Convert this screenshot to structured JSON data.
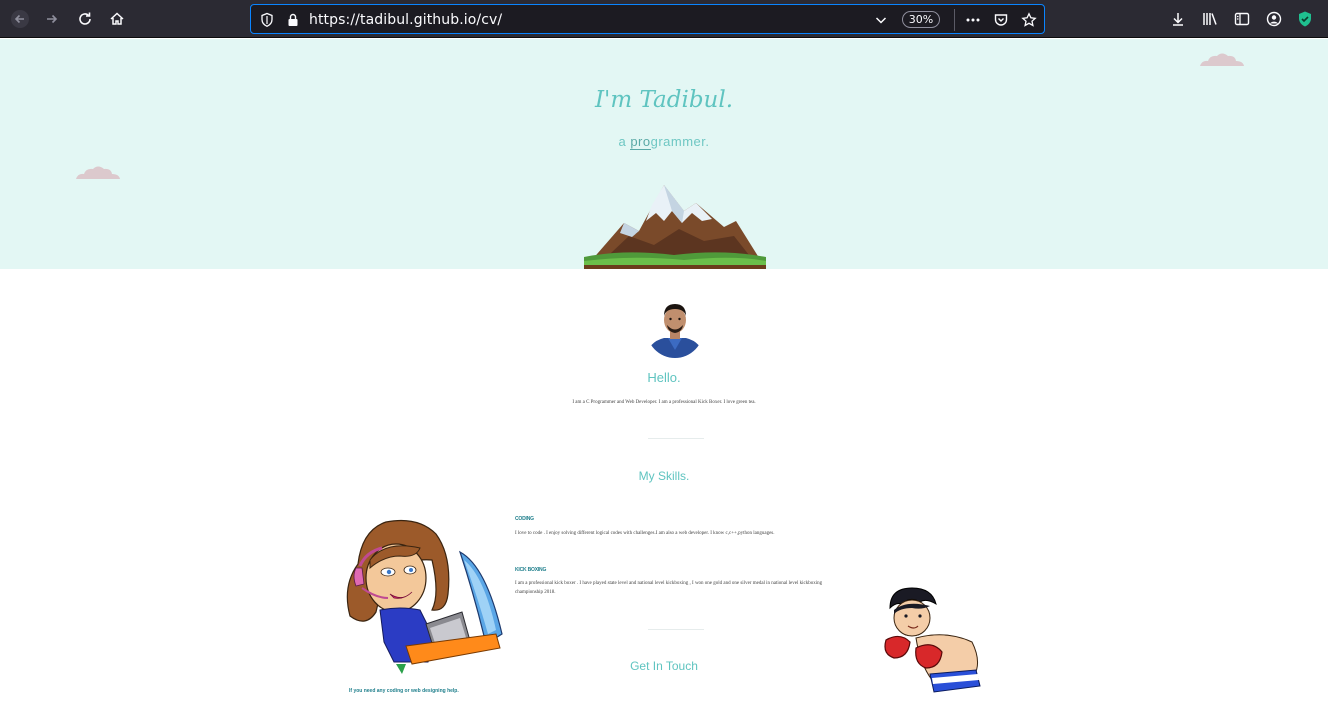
{
  "browser": {
    "url": "https://tadibul.github.io/cv/",
    "zoom": "30%",
    "colors": {
      "toolbar": "#2b2a33",
      "urlbar": "#1c1b22",
      "focus": "#0a84ff"
    }
  },
  "hero": {
    "title": "I'm Tadibul.",
    "subtitle_prefix": "a ",
    "subtitle_highlight": "pro",
    "subtitle_suffix": "grammer."
  },
  "about": {
    "greeting": "Hello.",
    "intro": "I am a C Programmer and Web Developer. I am a professional Kick Boxer. I love green tea."
  },
  "skills": {
    "title": "My Skills.",
    "items": [
      {
        "heading": "CODING",
        "text": "I love to code . I enjoy solving different logical codes with challenges.I am also a web developer. I know c,c++,python languages."
      },
      {
        "heading": "KICK BOXING",
        "text": "I am a professional kick boxer . I have played state level and national level kickboxing , I won one gold and one silver medal in national level kickboxing championship 2018."
      }
    ]
  },
  "contact": {
    "title": "Get In Touch",
    "help_text": "If you need any coding or web designing help."
  },
  "theme": {
    "accent": "#5fc4c0",
    "hero_bg": "#e3f7f4",
    "heading_dark": "#1f7f8c"
  }
}
